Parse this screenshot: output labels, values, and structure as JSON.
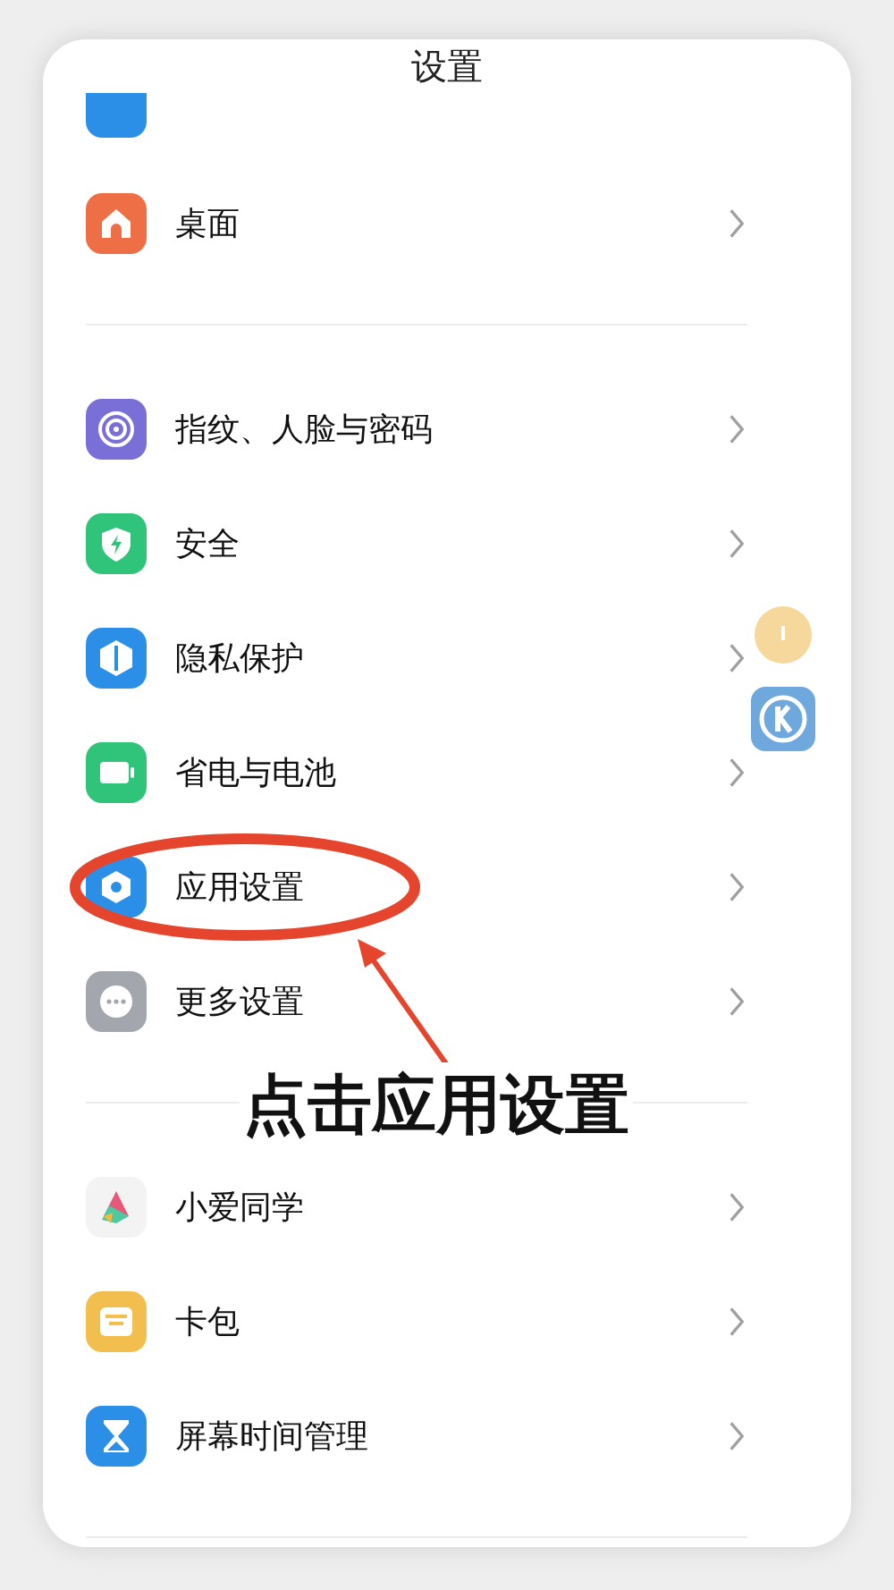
{
  "title": "设置",
  "sections": [
    {
      "items": [
        {
          "kind": "home",
          "label": "桌面"
        }
      ]
    },
    {
      "items": [
        {
          "kind": "fingerprint",
          "label": "指纹、人脸与密码"
        },
        {
          "kind": "security",
          "label": "安全"
        },
        {
          "kind": "privacy",
          "label": "隐私保护"
        },
        {
          "kind": "battery",
          "label": "省电与电池"
        },
        {
          "kind": "apps",
          "label": "应用设置"
        },
        {
          "kind": "more",
          "label": "更多设置"
        }
      ]
    },
    {
      "items": [
        {
          "kind": "assistant",
          "label": "小爱同学"
        },
        {
          "kind": "wallet",
          "label": "卡包"
        },
        {
          "kind": "hourglass",
          "label": "屏幕时间管理"
        }
      ]
    }
  ],
  "annotation": {
    "caption": "点击应用设置"
  }
}
